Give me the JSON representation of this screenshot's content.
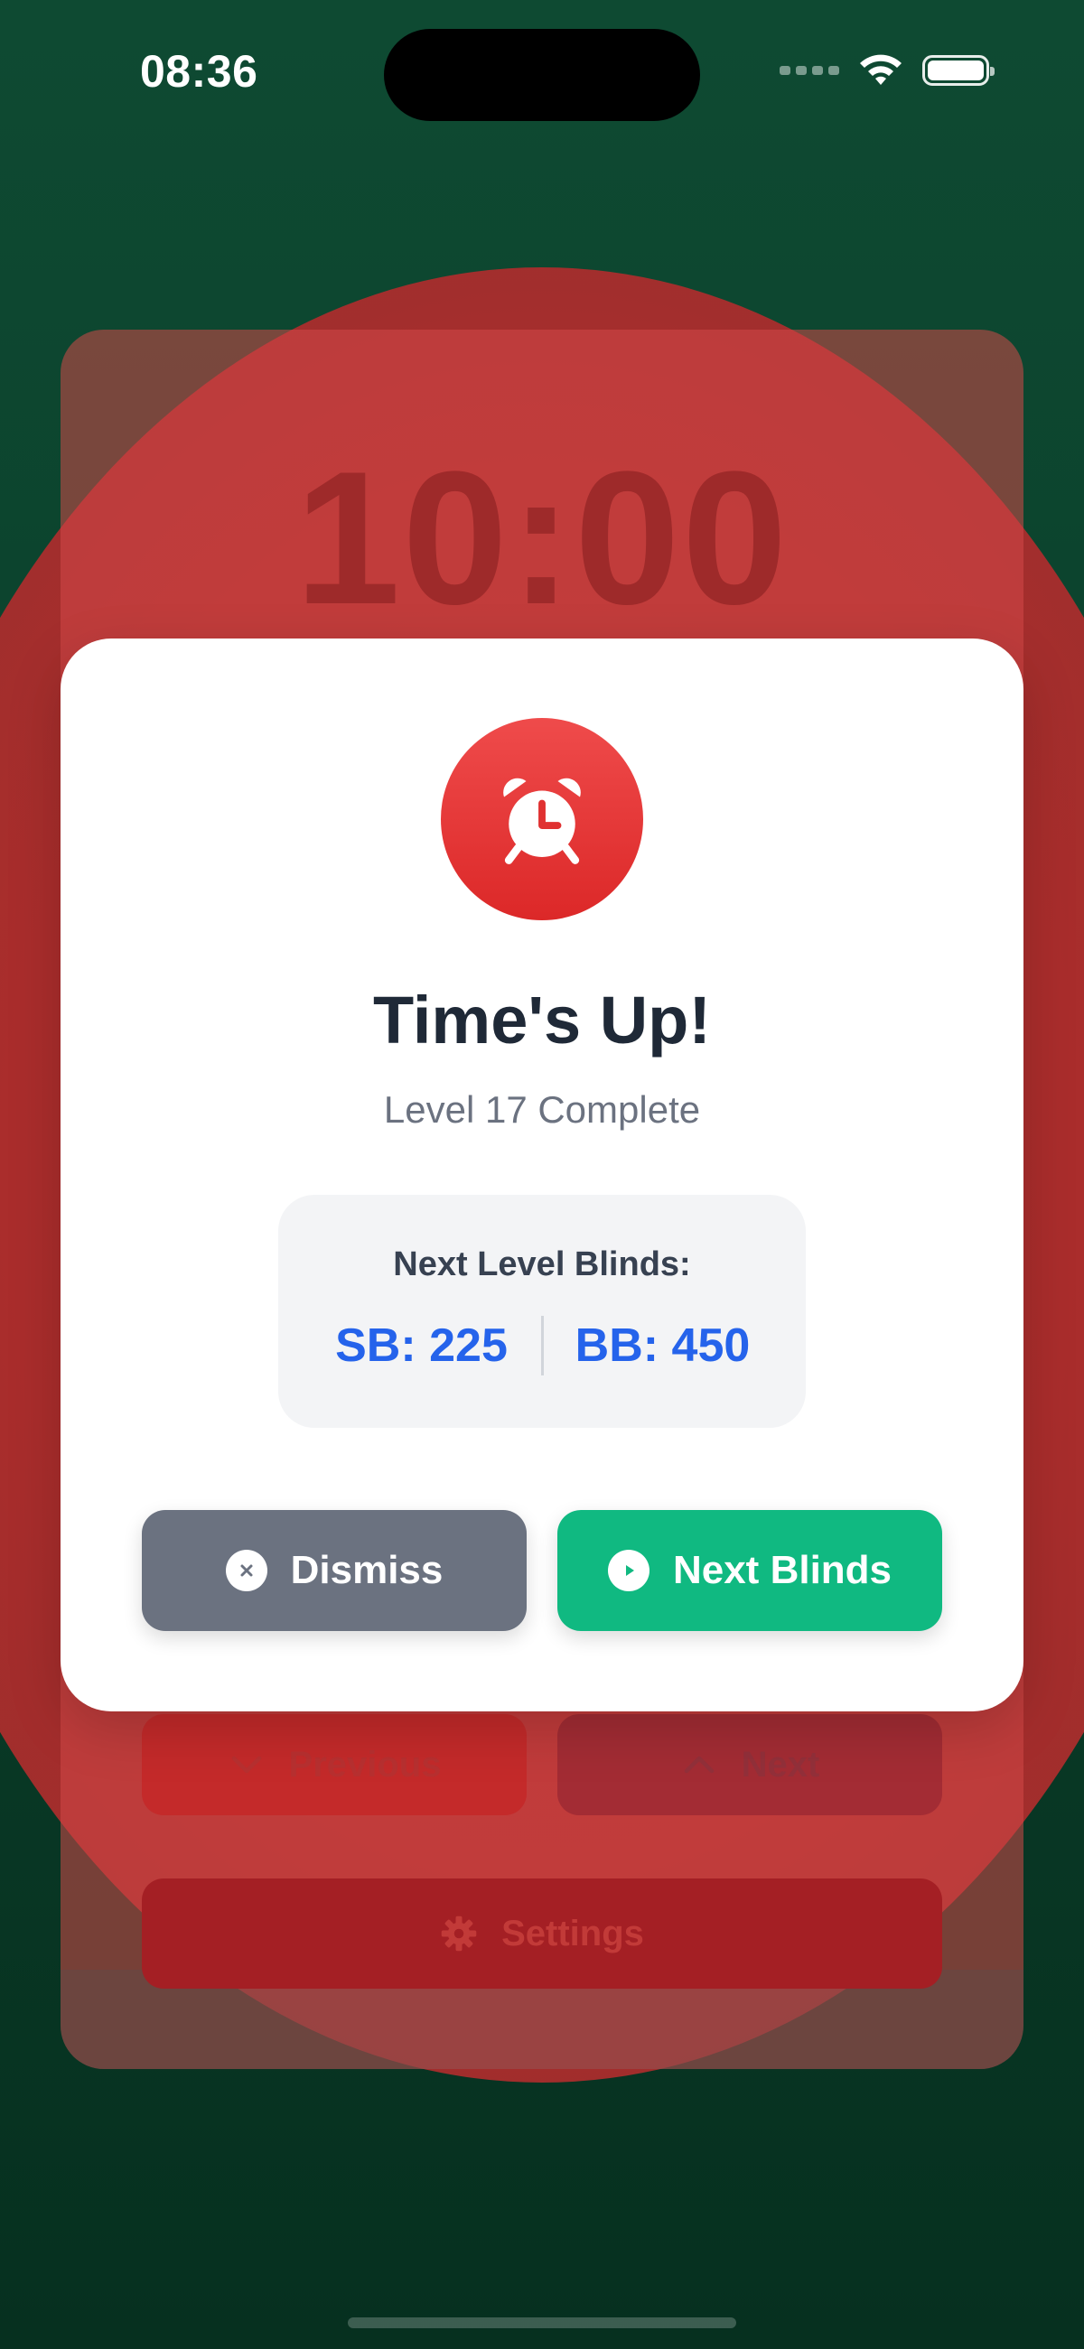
{
  "status_bar": {
    "time": "08:36"
  },
  "background_timer": {
    "time_display": "10:00",
    "previous_label": "Previous",
    "next_label": "Next",
    "settings_label": "Settings"
  },
  "modal": {
    "title": "Time's Up!",
    "subtitle": "Level 17 Complete",
    "blinds_heading": "Next Level Blinds:",
    "small_blind": "SB: 225",
    "big_blind": "BB: 450",
    "dismiss_label": "Dismiss",
    "next_blinds_label": "Next Blinds"
  },
  "colors": {
    "background_green": "#0e4a32",
    "overlay_red": "#be2a2a",
    "alarm_red": "#dc2828",
    "blinds_blue": "#2563eb",
    "dismiss_gray": "#6b7280",
    "next_green": "#10b981"
  },
  "icons": {
    "alarm": "alarm-clock-icon",
    "dismiss": "close-circle-icon",
    "next": "play-circle-icon",
    "previous": "chevron-down-icon",
    "next_level": "chevron-up-icon",
    "settings": "gear-icon"
  }
}
